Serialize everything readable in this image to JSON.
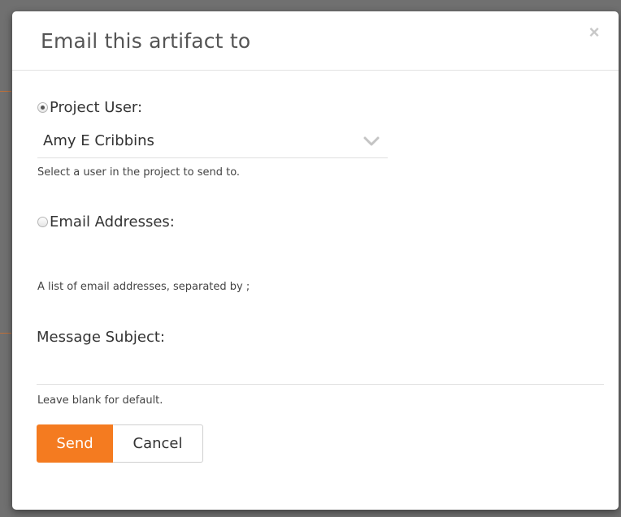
{
  "dialog": {
    "title": "Email this artifact to",
    "close_glyph": "×",
    "close_icon": "close-icon"
  },
  "project_user": {
    "label": "Project User:",
    "checked": true,
    "selected_user": "Amy E Cribbins",
    "dropdown_icon": "chevron-down-icon",
    "help": "Select a user in the project to send to."
  },
  "email_addresses": {
    "label": "Email Addresses:",
    "checked": false,
    "help": "A list of email addresses, separated by ;"
  },
  "message_subject": {
    "label": "Message Subject:",
    "value": "",
    "help": "Leave blank for default."
  },
  "buttons": {
    "send": "Send",
    "cancel": "Cancel"
  },
  "colors": {
    "accent": "#f47b20",
    "overlay": "#707070"
  }
}
